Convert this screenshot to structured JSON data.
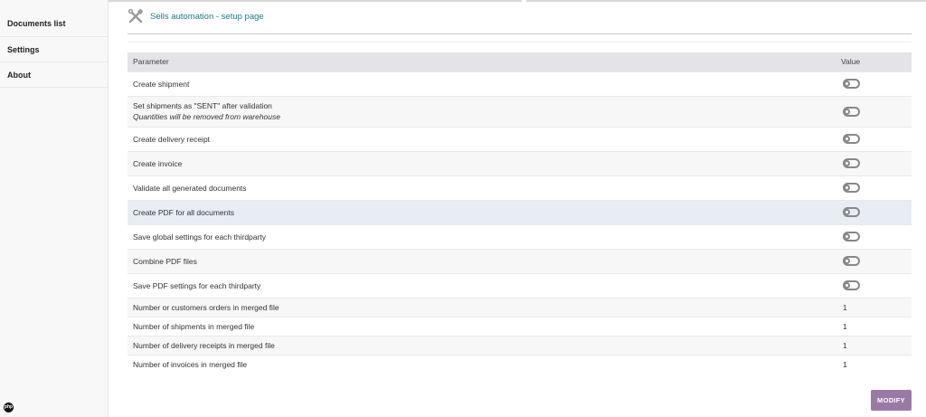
{
  "sidebar": {
    "items": [
      {
        "label": "Documents list"
      },
      {
        "label": "Settings"
      },
      {
        "label": "About"
      }
    ],
    "bottom_icon": "php"
  },
  "header": {
    "icon": "wrench-screwdriver-icon",
    "title": "Sells automation - setup page"
  },
  "table": {
    "col_parameter": "Parameter",
    "col_value": "Value",
    "toggle_rows": [
      {
        "label": "Create shipment",
        "enabled": false
      },
      {
        "label": "Set shipments as \"SENT\" after validation",
        "note": "Quantities will be removed from warehouse",
        "enabled": false
      },
      {
        "label": "Create delivery receipt",
        "enabled": false
      },
      {
        "label": "Create invoice",
        "enabled": false
      },
      {
        "label": "Validate all generated documents",
        "enabled": false
      },
      {
        "label": "Create PDF for all documents",
        "enabled": false
      },
      {
        "label": "Save global settings for each thirdparty",
        "enabled": false
      },
      {
        "label": "Combine PDF files",
        "enabled": false
      },
      {
        "label": "Save PDF settings for each thirdparty",
        "enabled": false
      }
    ],
    "number_rows": [
      {
        "label": "Number or customers orders in merged file",
        "value": "1"
      },
      {
        "label": "Number of shipments in merged file",
        "value": "1"
      },
      {
        "label": "Number of delivery receipts in merged file",
        "value": "1"
      },
      {
        "label": "Number of invoices in merged file",
        "value": "1"
      }
    ]
  },
  "footer": {
    "modify_label": "MODIFY"
  },
  "colors": {
    "accent_link": "#1b7a86",
    "button": "#9b79a6",
    "header_row": "#e3e4e8",
    "highlight_row": "#e8ecf3"
  }
}
